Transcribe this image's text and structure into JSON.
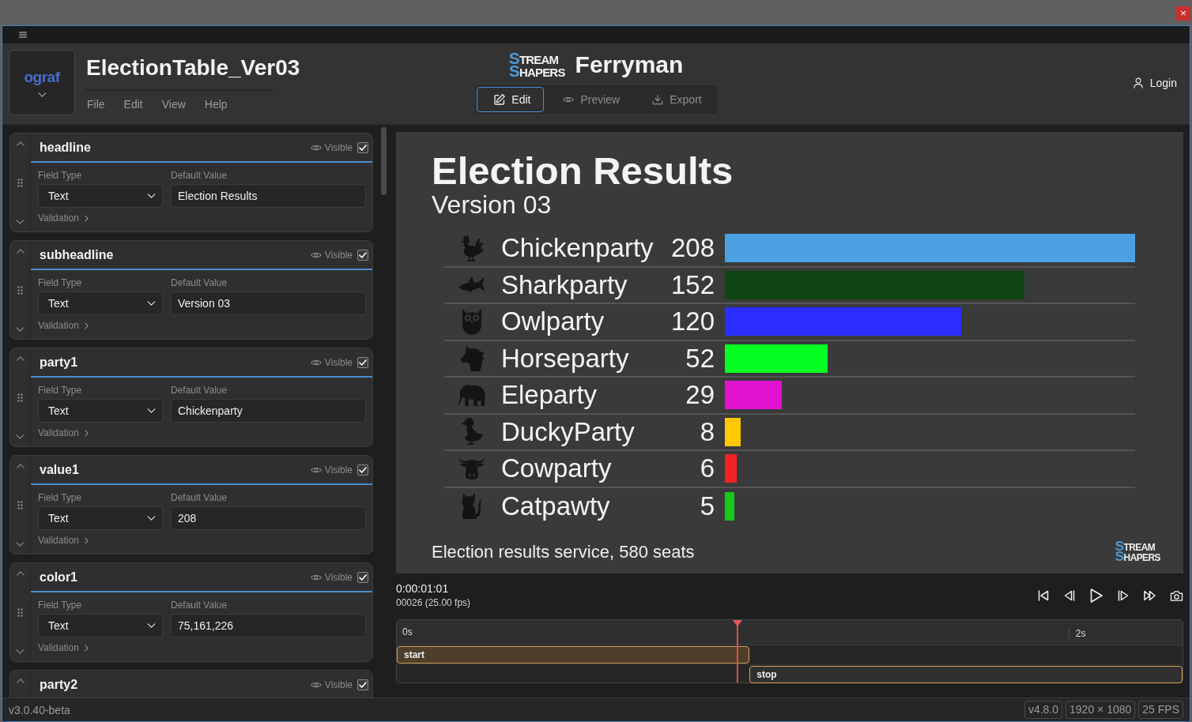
{
  "window": {
    "close": "×"
  },
  "header": {
    "logo": "ograf",
    "title": "ElectionTable_Ver03",
    "menu": [
      "File",
      "Edit",
      "View",
      "Help"
    ],
    "brand_logo": [
      "STREAM",
      "SHAPERS"
    ],
    "product": "Ferryman",
    "modes": [
      {
        "label": "Edit",
        "selected": true
      },
      {
        "label": "Preview",
        "selected": false
      },
      {
        "label": "Export",
        "selected": false
      }
    ],
    "login": "Login"
  },
  "fields": [
    {
      "name": "headline",
      "visible_label": "Visible",
      "visible": true,
      "type_label": "Field Type",
      "type": "Text",
      "value_label": "Default Value",
      "value": "Election Results",
      "validation": "Validation"
    },
    {
      "name": "subheadline",
      "visible_label": "Visible",
      "visible": true,
      "type_label": "Field Type",
      "type": "Text",
      "value_label": "Default Value",
      "value": "Version 03",
      "validation": "Validation"
    },
    {
      "name": "party1",
      "visible_label": "Visible",
      "visible": true,
      "type_label": "Field Type",
      "type": "Text",
      "value_label": "Default Value",
      "value": "Chickenparty",
      "validation": "Validation"
    },
    {
      "name": "value1",
      "visible_label": "Visible",
      "visible": true,
      "type_label": "Field Type",
      "type": "Text",
      "value_label": "Default Value",
      "value": "208",
      "validation": "Validation"
    },
    {
      "name": "color1",
      "visible_label": "Visible",
      "visible": true,
      "type_label": "Field Type",
      "type": "Text",
      "value_label": "Default Value",
      "value": "75,161,226",
      "validation": "Validation"
    },
    {
      "name": "party2",
      "visible_label": "Visible",
      "visible": true
    }
  ],
  "preview": {
    "title": "Election Results",
    "subtitle": "Version 03",
    "rows": [
      {
        "party": "Chickenparty",
        "votes": "208",
        "level": 1,
        "color": "#4ba1e2"
      },
      {
        "party": "Sharkparty",
        "votes": "152",
        "level": 0.731,
        "color": "#0e4512"
      },
      {
        "party": "Owlparty",
        "votes": "120",
        "level": 0.577,
        "color": "#2b2dff"
      },
      {
        "party": "Horseparty",
        "votes": "52",
        "level": 0.25,
        "color": "#05ff22"
      },
      {
        "party": "Eleparty",
        "votes": "29",
        "level": 0.139,
        "color": "#e012cf"
      },
      {
        "party": "DuckyParty",
        "votes": "8",
        "level": 0.038,
        "color": "#ffc800"
      },
      {
        "party": "Cowparty",
        "votes": "6",
        "level": 0.029,
        "color": "#f22222"
      },
      {
        "party": "Catpawty",
        "votes": "5",
        "level": 0.024,
        "color": "#17c917"
      }
    ],
    "footer": "Election results service, 580 seats",
    "logo": [
      "STREAM",
      "SHAPERS"
    ]
  },
  "player": {
    "timecode": "0:00:01:01",
    "frame": "00026 (25.00 fps)"
  },
  "timeline": {
    "ruler": [
      "0s",
      "2s"
    ],
    "playhead": {
      "level": 0.434
    },
    "clips": [
      {
        "label": "start",
        "active": true
      },
      {
        "label": "stop",
        "active": false
      }
    ]
  },
  "status_bar": {
    "version": "v3.0.40-beta",
    "badges": [
      "v4.8.0",
      "1920 × 1080",
      "25 FPS"
    ]
  }
}
